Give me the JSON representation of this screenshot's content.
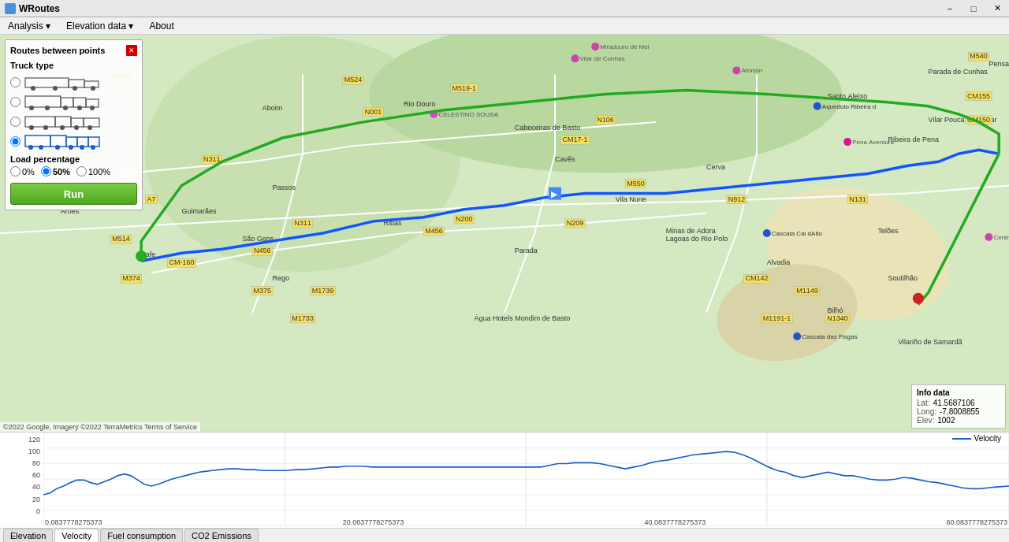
{
  "titlebar": {
    "icon": "W",
    "title": "WRoutes",
    "minimize": "−",
    "maximize": "□",
    "close": "✕"
  },
  "menubar": {
    "items": [
      {
        "label": "Analysis",
        "id": "menu-analysis"
      },
      {
        "label": "Elevation data",
        "id": "menu-elevation"
      },
      {
        "label": "About",
        "id": "menu-about"
      }
    ]
  },
  "panel": {
    "title": "Routes between points",
    "truck_type_label": "Truck type",
    "trucks": [
      {
        "id": "t1",
        "selected": false
      },
      {
        "id": "t2",
        "selected": false
      },
      {
        "id": "t3",
        "selected": false
      },
      {
        "id": "t4",
        "selected": true
      }
    ],
    "load_percentage_label": "Load percentage",
    "load_options": [
      "0%",
      "50%",
      "100%"
    ],
    "load_selected": "50%",
    "run_label": "Run"
  },
  "info_box": {
    "title": "Info data",
    "lat_label": "Lat:",
    "lat_value": "41.5687106",
    "lon_label": "Long:",
    "lon_value": "-7.8008855",
    "elev_label": "Elev:",
    "elev_value": "1002"
  },
  "chart": {
    "y_labels": [
      "120",
      "100",
      "80",
      "60",
      "40",
      "20",
      "0"
    ],
    "x_labels": [
      "0.0837778275373",
      "20.0837778275373",
      "40.0837778275373",
      "60.0837778275373"
    ],
    "legend_label": "Velocity",
    "legend_color": "#1a5fc8"
  },
  "chart_tabs": [
    {
      "label": "Elevation",
      "active": false
    },
    {
      "label": "Velocity",
      "active": true
    },
    {
      "label": "Fuel consumption",
      "active": false
    },
    {
      "label": "CO2 Emissions",
      "active": false
    }
  ],
  "footer": {
    "input1": "",
    "input2": "",
    "separator": "--"
  },
  "attribution": "©2022 Google, Imagery ©2022 TerraMetrics  Terms of Service"
}
